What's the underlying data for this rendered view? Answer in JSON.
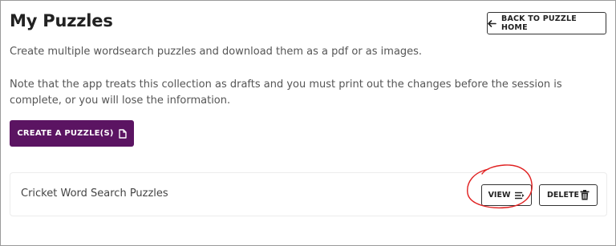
{
  "page": {
    "title": "My Puzzles",
    "description": "Create multiple wordsearch puzzles and download them as a pdf or as images.",
    "note": "Note that the app treats this collection as drafts and you must print out the changes before the session is complete, or you will lose the information."
  },
  "header": {
    "back_label": "BACK TO PUZZLE HOME",
    "back_icon": "arrow-left-icon"
  },
  "actions": {
    "create_label": "CREATE A PUZZLE(S)",
    "create_icon": "file-icon"
  },
  "puzzles": [
    {
      "name": "Cricket Word Search Puzzles",
      "view_label": "VIEW",
      "view_icon": "list-icon",
      "delete_label": "DELETE",
      "delete_icon": "trash-icon"
    }
  ],
  "colors": {
    "primary": "#5b1462",
    "annotation": "#e02020",
    "border": "#333333"
  }
}
